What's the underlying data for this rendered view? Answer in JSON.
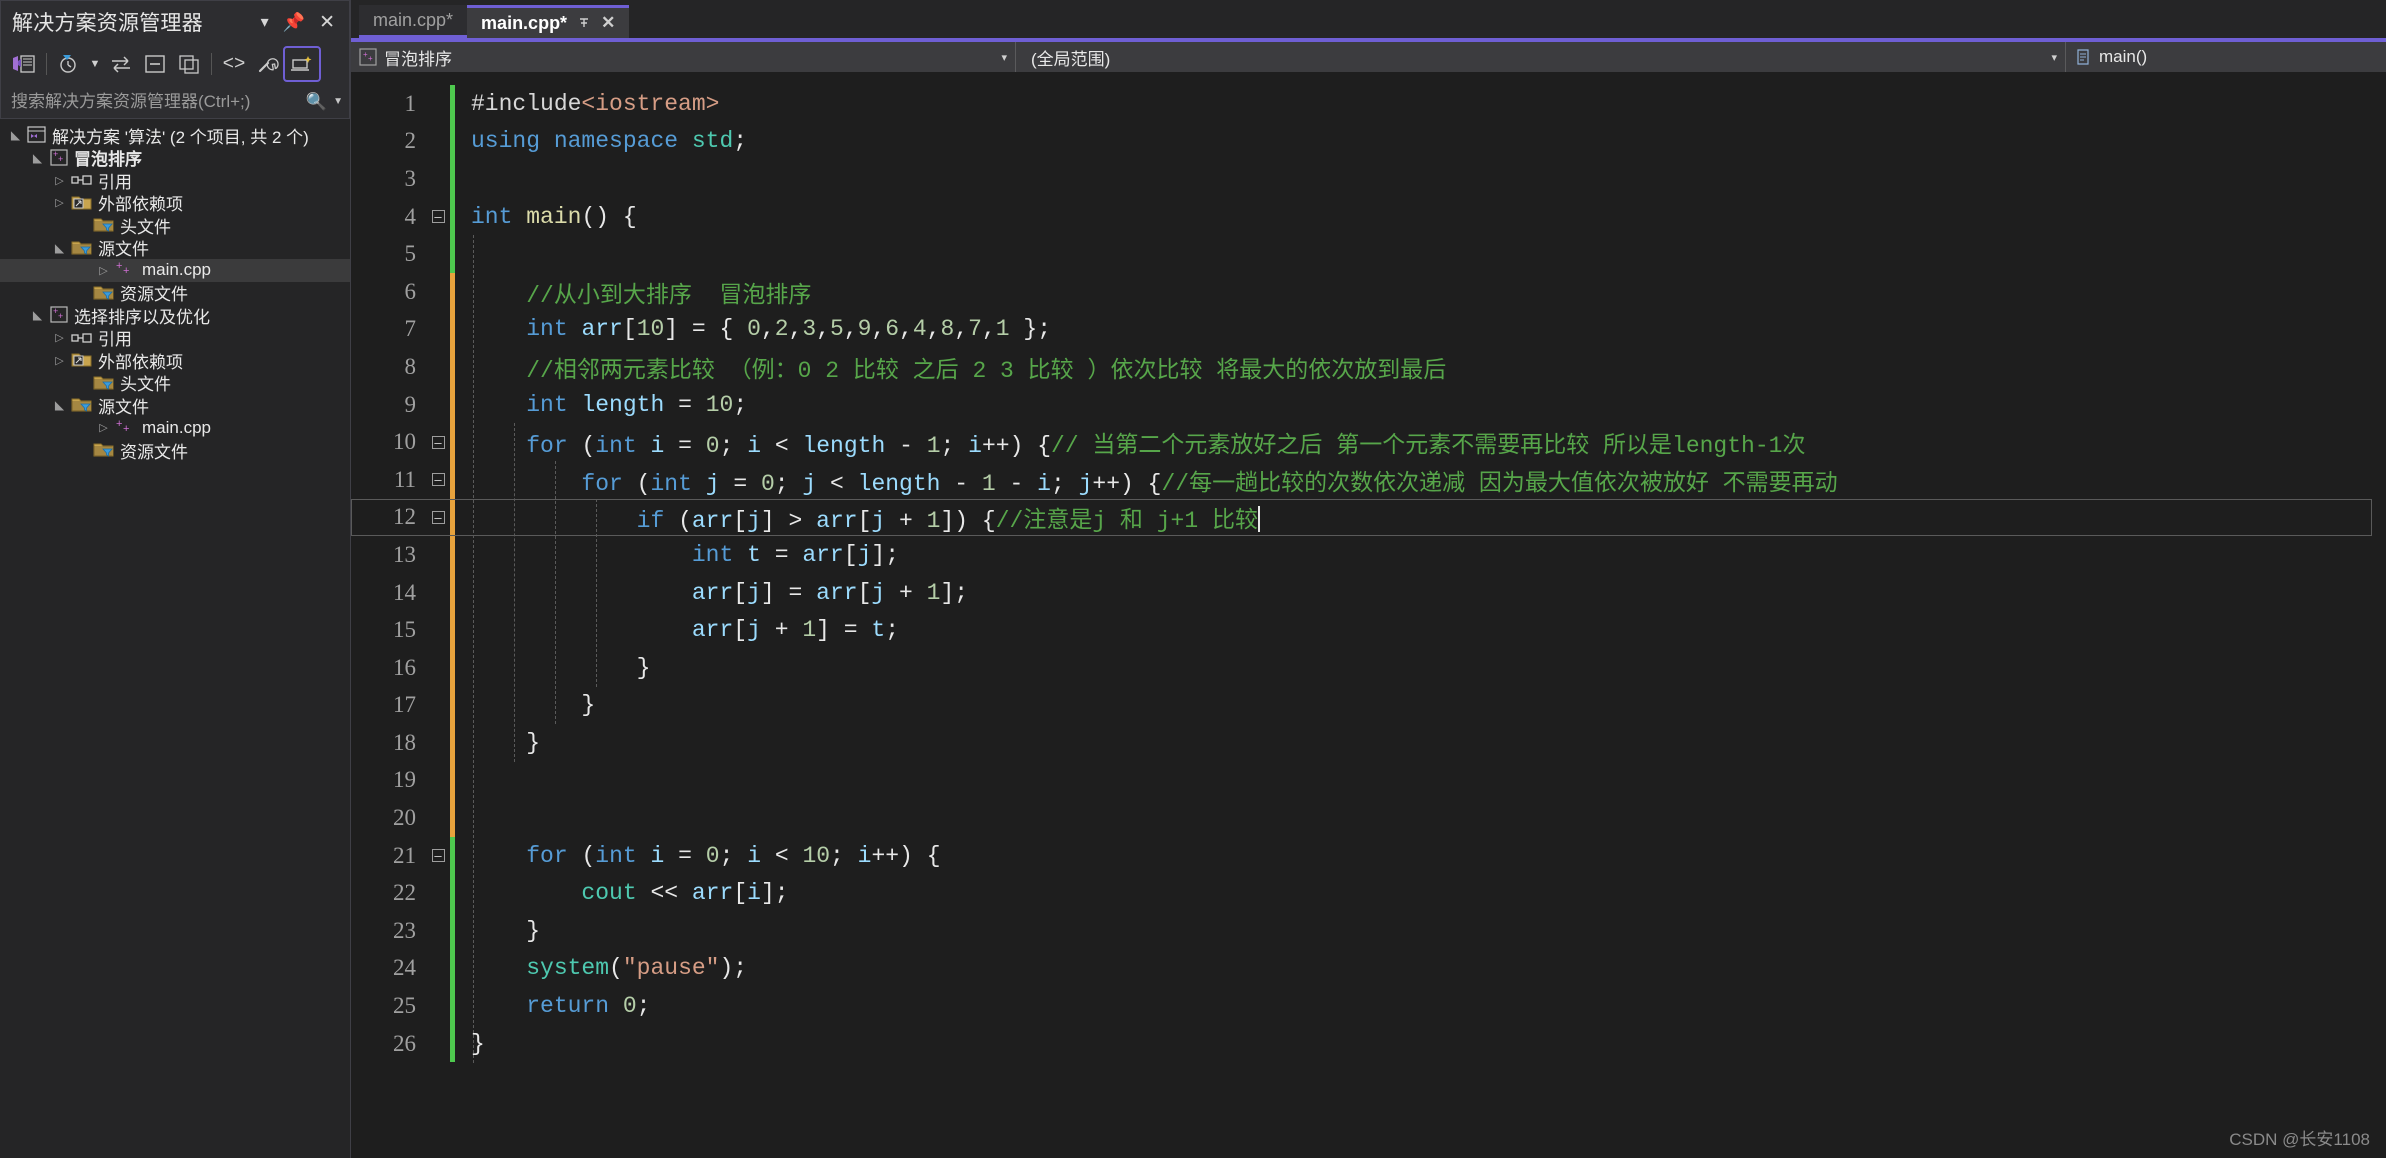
{
  "solution_explorer": {
    "title": "解决方案资源管理器",
    "header_buttons": [
      {
        "name": "dropdown-icon",
        "glyph": "▾"
      },
      {
        "name": "pin-icon",
        "glyph": "⊥"
      },
      {
        "name": "close-icon",
        "glyph": "✕"
      }
    ],
    "toolbar": [
      {
        "name": "home-icon",
        "label": "主页"
      },
      {
        "name": "pending-changes-icon",
        "label": "挂起的更改筛选器"
      },
      {
        "name": "sync-icon",
        "label": "在活动文件间同步"
      },
      {
        "name": "collapse-all-icon",
        "label": "全部折叠"
      },
      {
        "name": "show-all-files-icon",
        "label": "显示所有文件"
      },
      {
        "name": "code-view-icon",
        "label": "代码视图"
      },
      {
        "name": "properties-icon",
        "label": "属性"
      },
      {
        "name": "preview-icon",
        "label": "预览所选项"
      }
    ],
    "search_placeholder": "搜索解决方案资源管理器(Ctrl+;)",
    "tree": [
      {
        "label": "解决方案 '算法' (2 个项目, 共 2 个)",
        "indent": 0,
        "twisty": "▲",
        "icon": "solution-icon",
        "bold": false,
        "selected": false
      },
      {
        "label": "冒泡排序",
        "indent": 1,
        "twisty": "▲",
        "icon": "cpp-project-icon",
        "bold": true,
        "selected": false
      },
      {
        "label": "引用",
        "indent": 2,
        "twisty": "▶",
        "icon": "references-icon",
        "bold": false,
        "selected": false
      },
      {
        "label": "外部依赖项",
        "indent": 2,
        "twisty": "▶",
        "icon": "external-deps-icon",
        "bold": false,
        "selected": false
      },
      {
        "label": "头文件",
        "indent": 3,
        "twisty": "",
        "icon": "filter-folder-icon",
        "bold": false,
        "selected": false
      },
      {
        "label": "源文件",
        "indent": 2,
        "twisty": "▲",
        "icon": "filter-folder-icon",
        "bold": false,
        "selected": false
      },
      {
        "label": "main.cpp",
        "indent": 4,
        "twisty": "▶",
        "icon": "cpp-file-icon",
        "bold": false,
        "selected": true
      },
      {
        "label": "资源文件",
        "indent": 3,
        "twisty": "",
        "icon": "filter-folder-icon",
        "bold": false,
        "selected": false
      },
      {
        "label": "选择排序以及优化",
        "indent": 1,
        "twisty": "▲",
        "icon": "cpp-project-icon",
        "bold": false,
        "selected": false
      },
      {
        "label": "引用",
        "indent": 2,
        "twisty": "▶",
        "icon": "references-icon",
        "bold": false,
        "selected": false
      },
      {
        "label": "外部依赖项",
        "indent": 2,
        "twisty": "▶",
        "icon": "external-deps-icon",
        "bold": false,
        "selected": false
      },
      {
        "label": "头文件",
        "indent": 3,
        "twisty": "",
        "icon": "filter-folder-icon",
        "bold": false,
        "selected": false
      },
      {
        "label": "源文件",
        "indent": 2,
        "twisty": "▲",
        "icon": "filter-folder-icon",
        "bold": false,
        "selected": false
      },
      {
        "label": "main.cpp",
        "indent": 4,
        "twisty": "▶",
        "icon": "cpp-file-icon",
        "bold": false,
        "selected": false
      },
      {
        "label": "资源文件",
        "indent": 3,
        "twisty": "",
        "icon": "filter-folder-icon",
        "bold": false,
        "selected": false
      }
    ]
  },
  "tabs": [
    {
      "label": "main.cpp*",
      "active": false
    },
    {
      "label": "main.cpp*",
      "active": true,
      "pin": "⊥",
      "close": "✕"
    }
  ],
  "navbar": {
    "project": "冒泡排序",
    "scope": "(全局范围)",
    "member": "main()",
    "caret": "▾"
  },
  "editor": {
    "accent_color": "#6f5fd4",
    "background": "#1e1e1e",
    "lines": [
      {
        "n": "1",
        "change": "green",
        "fold": "",
        "code": "#include<iostream>"
      },
      {
        "n": "2",
        "change": "green",
        "fold": "",
        "code": "using namespace std;"
      },
      {
        "n": "3",
        "change": "green",
        "fold": "",
        "code": ""
      },
      {
        "n": "4",
        "change": "green",
        "fold": "-",
        "code": "int main() {"
      },
      {
        "n": "5",
        "change": "green",
        "fold": "",
        "code": ""
      },
      {
        "n": "6",
        "change": "orange",
        "fold": "",
        "code": "    //从小到大排序  冒泡排序"
      },
      {
        "n": "7",
        "change": "orange",
        "fold": "",
        "code": "    int arr[10] = { 0,2,3,5,9,6,4,8,7,1 };"
      },
      {
        "n": "8",
        "change": "orange",
        "fold": "",
        "code": "    //相邻两元素比较 （例：0 2 比较 之后 2 3 比较 ）依次比较 将最大的依次放到最后"
      },
      {
        "n": "9",
        "change": "orange",
        "fold": "",
        "code": "    int length = 10;"
      },
      {
        "n": "10",
        "change": "orange",
        "fold": "-",
        "code": "    for (int i = 0; i < length - 1; i++) {// 当第二个元素放好之后 第一个元素不需要再比较 所以是length-1次"
      },
      {
        "n": "11",
        "change": "orange",
        "fold": "-",
        "code": "        for (int j = 0; j < length - 1 - i; j++) {//每一趟比较的次数依次递减 因为最大值依次被放好 不需要再动"
      },
      {
        "n": "12",
        "change": "orange",
        "fold": "-",
        "code": "            if (arr[j] > arr[j + 1]) {//注意是j 和 j+1 比较",
        "current": true
      },
      {
        "n": "13",
        "change": "orange",
        "fold": "",
        "code": "                int t = arr[j];"
      },
      {
        "n": "14",
        "change": "orange",
        "fold": "",
        "code": "                arr[j] = arr[j + 1];"
      },
      {
        "n": "15",
        "change": "orange",
        "fold": "",
        "code": "                arr[j + 1] = t;"
      },
      {
        "n": "16",
        "change": "orange",
        "fold": "",
        "code": "            }"
      },
      {
        "n": "17",
        "change": "orange",
        "fold": "",
        "code": "        }"
      },
      {
        "n": "18",
        "change": "orange",
        "fold": "",
        "code": "    }"
      },
      {
        "n": "19",
        "change": "orange",
        "fold": "",
        "code": ""
      },
      {
        "n": "20",
        "change": "orange",
        "fold": "",
        "code": ""
      },
      {
        "n": "21",
        "change": "green",
        "fold": "-",
        "code": "    for (int i = 0; i < 10; i++) {"
      },
      {
        "n": "22",
        "change": "green",
        "fold": "",
        "code": "        cout << arr[i];"
      },
      {
        "n": "23",
        "change": "green",
        "fold": "",
        "code": "    }"
      },
      {
        "n": "24",
        "change": "green",
        "fold": "",
        "code": "    system(\"pause\");"
      },
      {
        "n": "25",
        "change": "green",
        "fold": "",
        "code": "    return 0;"
      },
      {
        "n": "26",
        "change": "green",
        "fold": "",
        "code": "}"
      }
    ]
  },
  "watermark": "CSDN @长安1108"
}
